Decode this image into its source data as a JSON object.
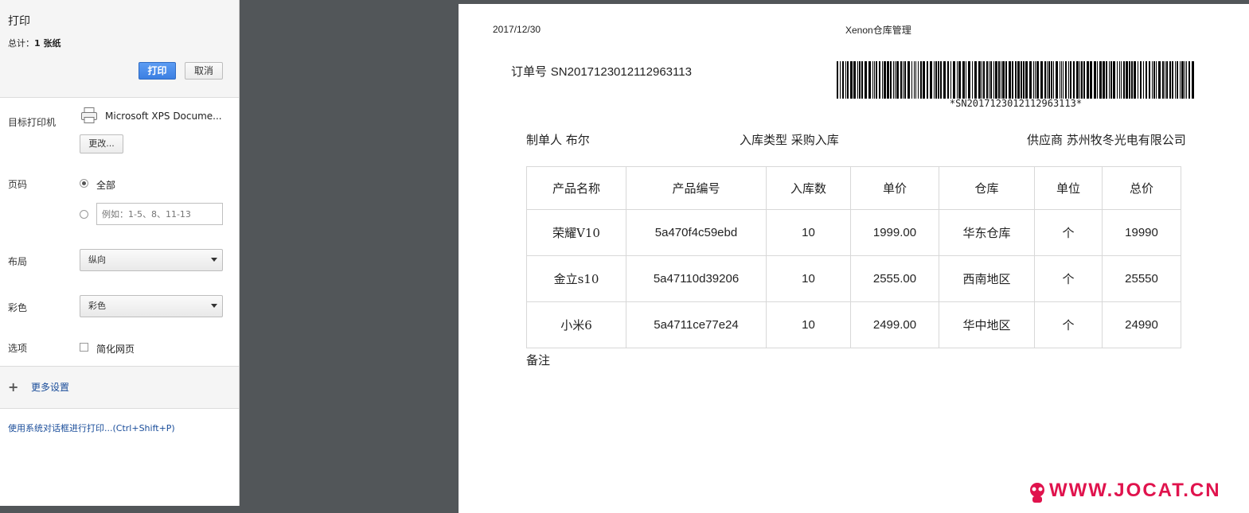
{
  "panel": {
    "title": "打印",
    "total_prefix": "总计：",
    "total_value": "1 张纸",
    "print_button": "打印",
    "cancel_button": "取消",
    "destination_label": "目标打印机",
    "printer_name": "Microsoft XPS Docume...",
    "change_button": "更改...",
    "pages_label": "页码",
    "pages_all": "全部",
    "pages_placeholder": "例如：1-5、8、11-13",
    "layout_label": "布局",
    "layout_value": "纵向",
    "color_label": "彩色",
    "color_value": "彩色",
    "options_label": "选项",
    "simplify_label": "简化网页",
    "more_settings": "更多设置",
    "system_dialog_link": "使用系统对话框进行打印...(Ctrl+Shift+P)"
  },
  "document": {
    "date": "2017/12/30",
    "header_title": "Xenon仓库管理",
    "order_label": "订单号",
    "order_no": "SN2017123012112963113",
    "barcode_text": "*SN2017123012112963113*",
    "creator": "制单人 布尔",
    "type": "入库类型 采购入库",
    "supplier": "供应商 苏州牧冬光电有限公司",
    "columns": [
      "产品名称",
      "产品编号",
      "入库数",
      "单价",
      "仓库",
      "单位",
      "总价"
    ],
    "rows": [
      [
        "荣耀V10",
        "5a470f4c59ebd",
        "10",
        "1999.00",
        "华东仓库",
        "个",
        "19990"
      ],
      [
        "金立s10",
        "5a47110d39206",
        "10",
        "2555.00",
        "西南地区",
        "个",
        "25550"
      ],
      [
        "小米6",
        "5a4711ce77e24",
        "10",
        "2499.00",
        "华中地区",
        "个",
        "24990"
      ]
    ],
    "remark_label": "备注"
  },
  "watermark": "WWW.JOCAT.CN",
  "colors": {
    "primary_button": "#3b7fe2",
    "preview_bg": "#525659",
    "link": "#1a4d9a",
    "watermark": "#e0134d"
  }
}
